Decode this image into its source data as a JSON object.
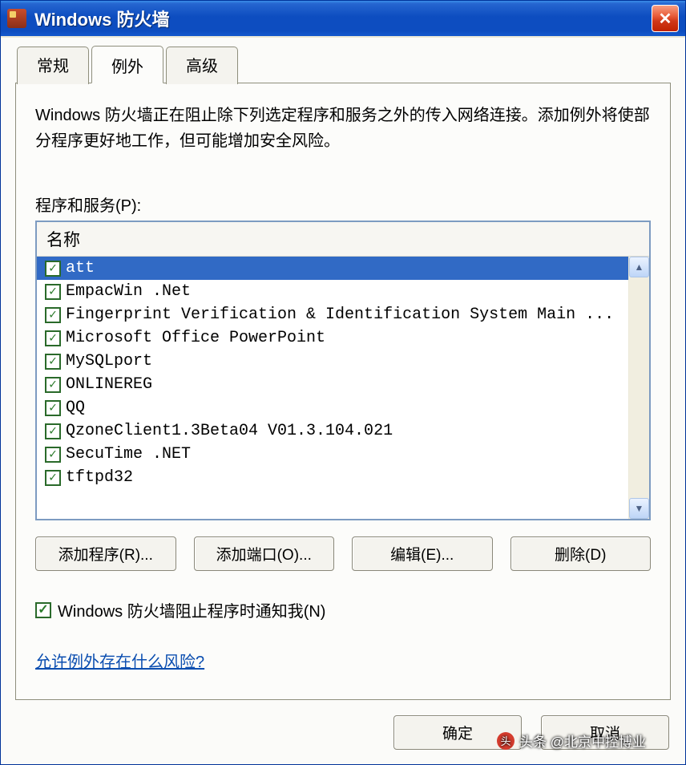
{
  "window": {
    "title": "Windows 防火墙"
  },
  "tabs": [
    {
      "label": "常规",
      "active": false
    },
    {
      "label": "例外",
      "active": true
    },
    {
      "label": "高级",
      "active": false
    }
  ],
  "body": {
    "description": "Windows 防火墙正在阻止除下列选定程序和服务之外的传入网络连接。添加例外将使部分程序更好地工作，但可能增加安全风险。",
    "list_label": "程序和服务(P):",
    "column_header": "名称",
    "items": [
      {
        "label": "att",
        "checked": true,
        "selected": true
      },
      {
        "label": "EmpacWin .Net",
        "checked": true,
        "selected": false
      },
      {
        "label": "Fingerprint Verification & Identification System Main ...",
        "checked": true,
        "selected": false
      },
      {
        "label": "Microsoft Office PowerPoint",
        "checked": true,
        "selected": false
      },
      {
        "label": "MySQLport",
        "checked": true,
        "selected": false
      },
      {
        "label": "ONLINEREG",
        "checked": true,
        "selected": false
      },
      {
        "label": "QQ",
        "checked": true,
        "selected": false
      },
      {
        "label": "QzoneClient1.3Beta04 V01.3.104.021",
        "checked": true,
        "selected": false
      },
      {
        "label": "SecuTime .NET",
        "checked": true,
        "selected": false
      },
      {
        "label": "tftpd32",
        "checked": true,
        "selected": false
      }
    ],
    "buttons": {
      "add_program": "添加程序(R)...",
      "add_port": "添加端口(O)...",
      "edit": "编辑(E)...",
      "delete": "删除(D)"
    },
    "notify": {
      "checked": true,
      "label": "Windows 防火墙阻止程序时通知我(N)"
    },
    "risk_link": "允许例外存在什么风险?"
  },
  "footer": {
    "ok": "确定",
    "cancel": "取消"
  },
  "watermark": "头条 @北京中控博业"
}
